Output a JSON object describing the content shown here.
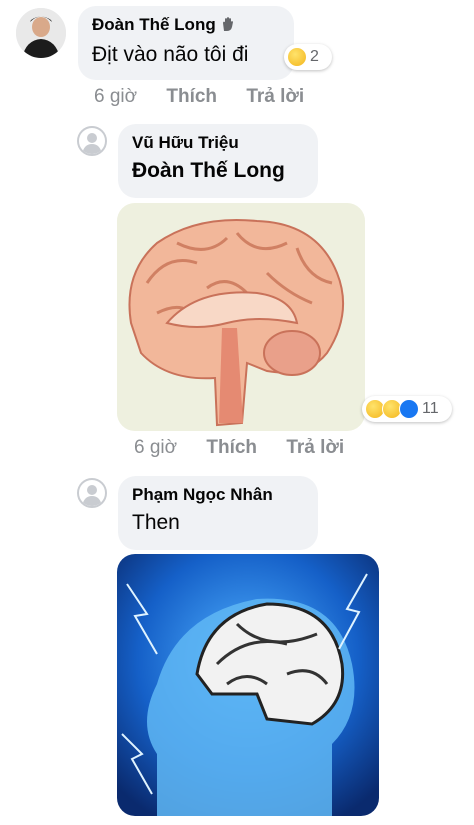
{
  "comments": [
    {
      "author": "Đoàn Thế Long",
      "text": "Địt vào não tôi đi",
      "reaction_count": "2",
      "reaction_icons": [
        "sad-icon"
      ],
      "time": "6 giờ",
      "like_label": "Thích",
      "reply_label": "Trả lời"
    },
    {
      "author": "Vũ Hữu Triệu",
      "mention": "Đoàn Thế Long",
      "reaction_count": "11",
      "reaction_icons": [
        "sad-icon",
        "haha-icon",
        "like-icon"
      ],
      "time": "6 giờ",
      "like_label": "Thích",
      "reply_label": "Trả lời"
    },
    {
      "author": "Phạm Ngọc Nhân",
      "text": "Then"
    }
  ],
  "colors": {
    "bubble": "#f0f2f5",
    "secondary_text": "#8a8d91",
    "like_blue": "#1877f2"
  }
}
